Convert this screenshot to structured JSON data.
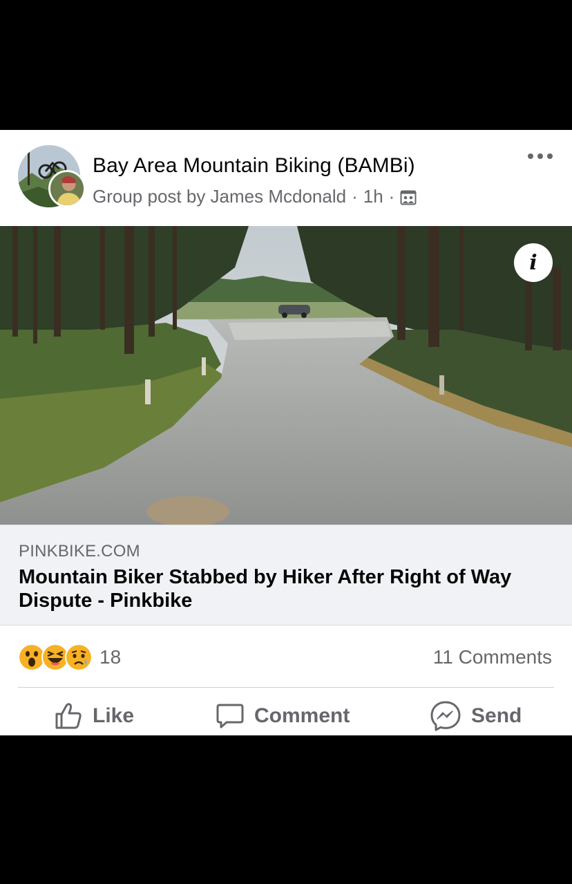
{
  "post": {
    "group_name": "Bay Area Mountain Biking (BAMBi)",
    "author_line": "Group post by James Mcdonald",
    "separator": "·",
    "time": "1h",
    "privacy_icon": "public-group-icon",
    "more_icon": "more-options-icon"
  },
  "link_preview": {
    "domain": "PINKBIKE.COM",
    "title": "Mountain Biker Stabbed by Hiker After Right of Way Dispute - Pinkbike",
    "info_glyph": "i"
  },
  "engagement": {
    "reactions": [
      "wow",
      "haha",
      "sad"
    ],
    "reaction_count": "18",
    "comments": "11 Comments"
  },
  "actions": {
    "like": "Like",
    "comment": "Comment",
    "send": "Send"
  },
  "colors": {
    "background": "#000000",
    "card": "#ffffff",
    "secondary_text": "#65676b",
    "link_box": "#f0f2f5"
  }
}
